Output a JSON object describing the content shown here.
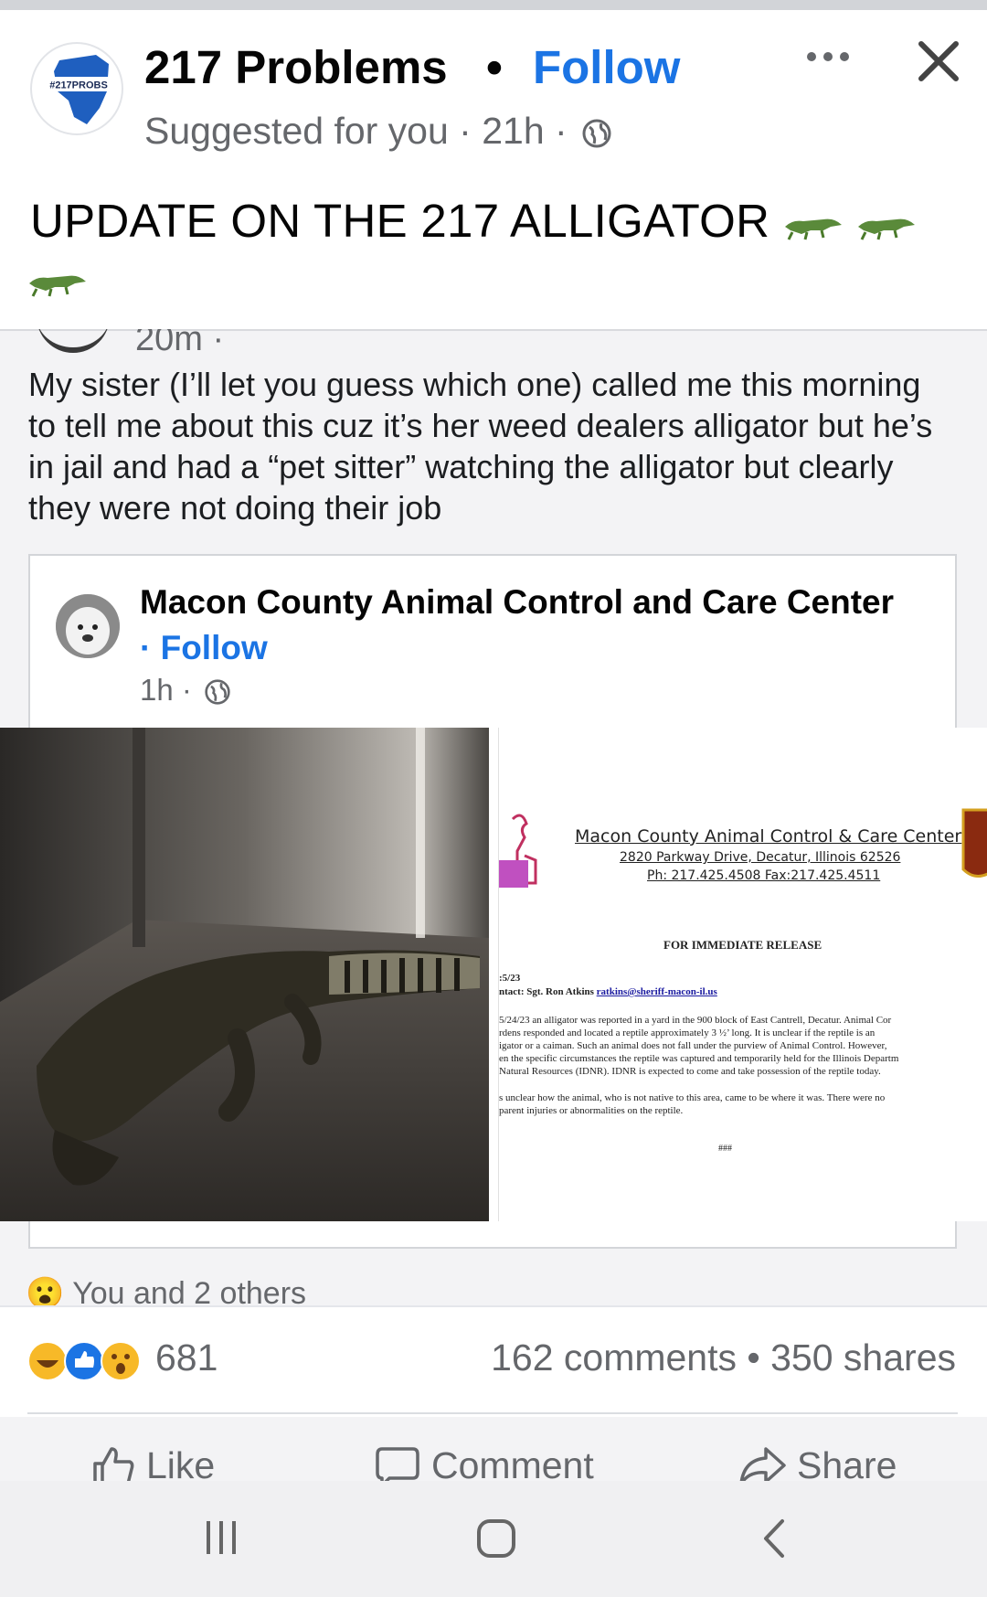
{
  "header": {
    "avatar_text": "#217PROBS",
    "page_name": "217 Problems",
    "separator": "•",
    "follow_label": "Follow",
    "meta": "Suggested for you · 21h ·",
    "more_icon": "more-horizontal-icon",
    "close_icon": "close-icon"
  },
  "post": {
    "headline": "UPDATE ON THE 217 ALLIGATOR"
  },
  "embedded": {
    "cut_meta": "20m ·",
    "body_text": "My sister (I’ll let you guess which one) called me this morning to tell me about this cuz it’s her weed dealers alligator but he’s in jail and had a “pet sitter” watching the alligator but clearly they were not doing their job",
    "card": {
      "name": "Macon County Animal Control and Care Center",
      "follow_label": "· Follow",
      "time": "1h ·"
    },
    "press_release": {
      "org": "Macon County Animal Control & Care Center",
      "address": "2820 Parkway Drive, Decatur, Illinois 62526",
      "phone": "Ph: 217.425.4508 Fax:217.425.4511",
      "heading": "FOR IMMEDIATE RELEASE",
      "date": ":5/23",
      "contact_prefix": "ntact: Sgt. Ron Atkins",
      "contact_email": "ratkins@sheriff-macon-il.us",
      "para1": [
        "5/24/23 an alligator was reported in a yard in the 900 block of East Cantrell, Decatur.  Animal Cor",
        "rdens responded and located a reptile approximately 3 ½’ long.  It is unclear if the reptile is an",
        "igator or a caiman.  Such an animal does not fall under the purview of Animal Control.  However,",
        "en the specific circumstances the reptile was captured and temporarily held for the Illinois Departm",
        "Natural Resources (IDNR).  IDNR is expected to come and take possession of the reptile today."
      ],
      "para2": [
        "s unclear how the animal, who is not native to this area, came to be where it was.  There were no",
        "parent injuries or abnormalities on the reptile."
      ],
      "end_mark": "###"
    },
    "reaction_text": "You and 2 others"
  },
  "stats": {
    "reaction_count": "681",
    "comments_shares": "162 comments • 350 shares"
  },
  "actions": {
    "like": "Like",
    "comment": "Comment",
    "share": "Share"
  },
  "colors": {
    "accent": "#1b74e4",
    "secondary_text": "#65676b"
  }
}
